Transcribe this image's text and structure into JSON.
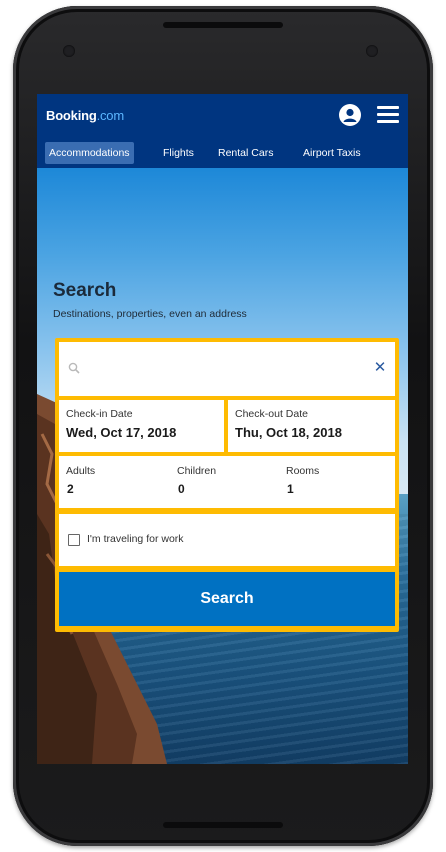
{
  "app": {
    "brand_name": "Booking",
    "brand_suffix": ".com",
    "brand_color": "#003580",
    "accent_color": "#febb02",
    "button_color": "#0071c2"
  },
  "header": {
    "account_icon": "account-icon",
    "menu_icon": "hamburger-menu-icon"
  },
  "tabs": [
    {
      "label": "Accommodations",
      "active": true
    },
    {
      "label": "Flights",
      "active": false
    },
    {
      "label": "Rental Cars",
      "active": false
    },
    {
      "label": "Airport Taxis",
      "active": false
    }
  ],
  "search": {
    "title": "Search",
    "subtitle": "Destinations, properties, even an address",
    "destination": {
      "value": "",
      "placeholder": "",
      "search_icon": "search-icon",
      "clear_icon": "close-icon"
    },
    "checkin": {
      "label": "Check-in Date",
      "value": "Wed, Oct 17, 2018"
    },
    "checkout": {
      "label": "Check-out Date",
      "value": "Thu, Oct 18, 2018"
    },
    "guests": {
      "adults": {
        "label": "Adults",
        "value": "2"
      },
      "children": {
        "label": "Children",
        "value": "0"
      },
      "rooms": {
        "label": "Rooms",
        "value": "1"
      }
    },
    "work_trip": {
      "label": "I'm traveling for work",
      "checked": false
    },
    "submit_label": "Search"
  }
}
